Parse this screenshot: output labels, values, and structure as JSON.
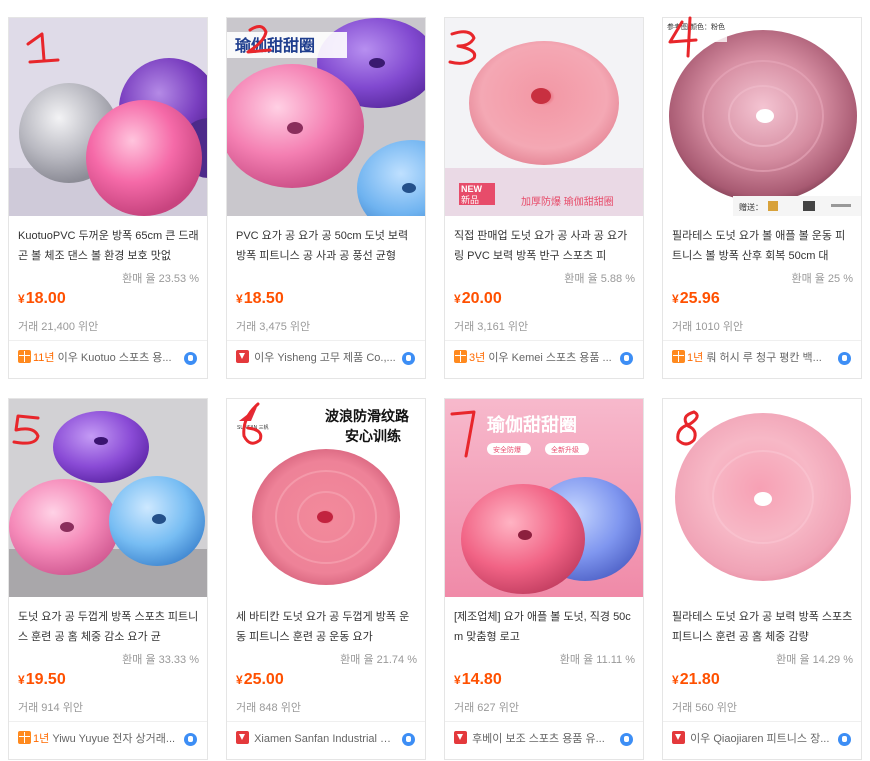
{
  "products": [
    {
      "marker": "1",
      "title": "KuotuoPVC 두꺼운 방폭 65cm 큰 드래곤 볼 체조 댄스 볼 환경 보호 맛없",
      "rate": "환매 율 23.53 %",
      "price": "18.00",
      "currency": "¥",
      "trade": "거래 21,400 위안",
      "years": "11년",
      "shop": "이우 Kuotuo 스포츠 용...",
      "badge": "gift"
    },
    {
      "marker": "2",
      "banner": "瑜伽甜甜圈",
      "title": "PVC 요가 공 요가 공 50cm 도넛 보력 방폭 피트니스 공 사과 공 풍선 균형",
      "rate": "",
      "price": "18.50",
      "currency": "¥",
      "trade": "거래 3,475 위안",
      "years": "",
      "shop": "이우 Yisheng 고무 제품 Co.,...",
      "badge": "red"
    },
    {
      "marker": "3",
      "new_tag_1": "NEW",
      "new_tag_2": "新品",
      "bottom_text": "加厚防爆 瑜伽甜甜圈",
      "title": "직접 판매업 도넛 요가 공 사과 공 요가 링 PVC 보력 방폭 반구 스포츠 피",
      "rate": "환매 율 5.88 %",
      "price": "20.00",
      "currency": "¥",
      "trade": "거래 3,161 위안",
      "years": "3년",
      "shop": "이우 Kemei 스포츠 용품 ...",
      "badge": "gift"
    },
    {
      "marker": "4",
      "corner_text": "参考图 颜色：粉色",
      "gift_text": "赠送：",
      "title": "필라테스 도넛 요가 볼 애플 볼 운동 피트니스 볼 방폭 산후 회복 50cm 대",
      "rate": "환매 율 25 %",
      "price": "25.96",
      "currency": "¥",
      "trade": "거래 1010 위안",
      "years": "1년",
      "shop": "뤄 허시 루 청구 평칸 백...",
      "badge": "gift"
    },
    {
      "marker": "5",
      "title": "도넛 요가 공 두껍게 방폭 스포츠 피트니스 훈련 공 홈 체중 감소 요가 균",
      "rate": "환매 율 33.33 %",
      "price": "19.50",
      "currency": "¥",
      "trade": "거래 914 위안",
      "years": "1년",
      "shop": "Yiwu Yuyue 전자 상거래...",
      "badge": "gift"
    },
    {
      "marker": "6",
      "banner_1": "波浪防滑纹路",
      "banner_2": "安心训练",
      "brand": "SUNFAN 三帆",
      "title": "세 바티칸 도넛 요가 공 두껍게 방폭 운동 피트니스 훈련 공 운동 요가",
      "rate": "환매 율 21.74 %",
      "price": "25.00",
      "currency": "¥",
      "trade": "거래 848 위안",
      "years": "",
      "shop": "Xiamen Sanfan Industrial Co...",
      "badge": "red"
    },
    {
      "marker": "7",
      "banner": "瑜伽甜甜圈",
      "pill_1": "安全防爆",
      "pill_2": "全新升级",
      "title": "[제조업체] 요가 애플 볼 도넛, 직경 50cm 맞춤형 로고",
      "rate": "환매 율 11.11 %",
      "price": "14.80",
      "currency": "¥",
      "trade": "거래 627 위안",
      "years": "",
      "shop": "후베이 보조 스포츠 용품 유...",
      "badge": "red"
    },
    {
      "marker": "8",
      "title": "필라테스 도넛 요가 공 보력 방폭 스포츠 피트니스 훈련 공 홈 체중 감량",
      "rate": "환매 율 14.29 %",
      "price": "21.80",
      "currency": "¥",
      "trade": "거래 560 위안",
      "years": "",
      "shop": "이우 Qiaojiaren 피트니스 장...",
      "badge": "red"
    }
  ],
  "colors": {
    "price": "#ff5000",
    "marker": "#e8262b",
    "pink": "#f07aa6",
    "purple": "#8a4bc8",
    "blue": "#6aaeea"
  }
}
